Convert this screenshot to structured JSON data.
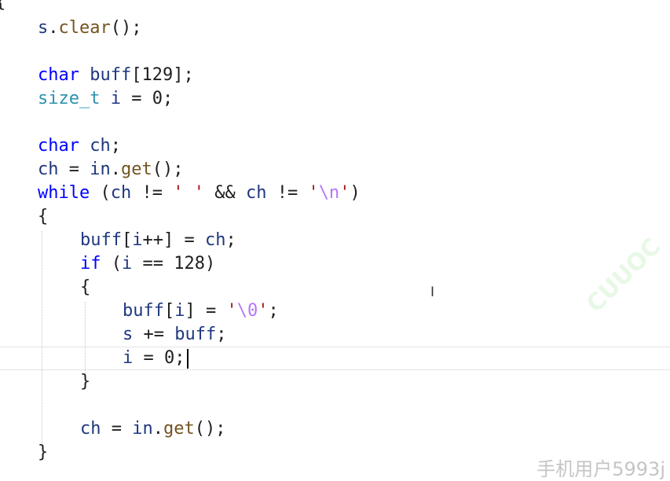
{
  "colors": {
    "keyword": "#0000ff",
    "type": "#2b91af",
    "identifier": "#1f377f",
    "function": "#74531f",
    "string": "#a31515",
    "escape": "#b776fb",
    "default": "#1e1e1e",
    "number": "#1e1e1e"
  },
  "icons": {
    "caret": "text-caret",
    "mouse": "ibeam-cursor"
  },
  "ibeam_glyph": "I",
  "top_fragment": "{",
  "watermark": "手机用户5993j",
  "ghost_watermark": "CUUOC",
  "code_lines": [
    {
      "tokens": [
        [
          "s",
          "identifier"
        ],
        [
          ".",
          "default"
        ],
        [
          "clear",
          "function"
        ],
        [
          "();",
          "default"
        ]
      ]
    },
    {
      "tokens": []
    },
    {
      "tokens": [
        [
          "char",
          "keyword"
        ],
        [
          " ",
          "default"
        ],
        [
          "buff",
          "identifier"
        ],
        [
          "[129];",
          "default"
        ]
      ]
    },
    {
      "tokens": [
        [
          "size_t",
          "type"
        ],
        [
          " ",
          "default"
        ],
        [
          "i",
          "identifier"
        ],
        [
          " = 0;",
          "default"
        ]
      ]
    },
    {
      "tokens": []
    },
    {
      "tokens": [
        [
          "char",
          "keyword"
        ],
        [
          " ",
          "default"
        ],
        [
          "ch",
          "identifier"
        ],
        [
          ";",
          "default"
        ]
      ]
    },
    {
      "tokens": [
        [
          "ch",
          "identifier"
        ],
        [
          " = ",
          "default"
        ],
        [
          "in",
          "identifier"
        ],
        [
          ".",
          "default"
        ],
        [
          "get",
          "function"
        ],
        [
          "();",
          "default"
        ]
      ]
    },
    {
      "tokens": [
        [
          "while",
          "keyword"
        ],
        [
          " (",
          "default"
        ],
        [
          "ch",
          "identifier"
        ],
        [
          " != ",
          "default"
        ],
        [
          "' '",
          "string"
        ],
        [
          " && ",
          "default"
        ],
        [
          "ch",
          "identifier"
        ],
        [
          " != ",
          "default"
        ],
        [
          "'",
          "string"
        ],
        [
          "\\n",
          "escape"
        ],
        [
          "'",
          "string"
        ],
        [
          ")",
          "default"
        ]
      ]
    },
    {
      "tokens": [
        [
          "{",
          "default"
        ]
      ]
    },
    {
      "tokens": [
        [
          "buff",
          "identifier"
        ],
        [
          "[",
          "default"
        ],
        [
          "i",
          "identifier"
        ],
        [
          "++] = ",
          "default"
        ],
        [
          "ch",
          "identifier"
        ],
        [
          ";",
          "default"
        ]
      ]
    },
    {
      "tokens": [
        [
          "if",
          "keyword"
        ],
        [
          " (",
          "default"
        ],
        [
          "i",
          "identifier"
        ],
        [
          " == 128)",
          "default"
        ]
      ]
    },
    {
      "tokens": [
        [
          "{",
          "default"
        ]
      ]
    },
    {
      "tokens": [
        [
          "buff",
          "identifier"
        ],
        [
          "[",
          "default"
        ],
        [
          "i",
          "identifier"
        ],
        [
          "] = ",
          "default"
        ],
        [
          "'",
          "string"
        ],
        [
          "\\0",
          "escape"
        ],
        [
          "'",
          "string"
        ],
        [
          ";",
          "default"
        ]
      ]
    },
    {
      "tokens": [
        [
          "s",
          "identifier"
        ],
        [
          " += ",
          "default"
        ],
        [
          "buff",
          "identifier"
        ],
        [
          ";",
          "default"
        ]
      ]
    },
    {
      "tokens": [
        [
          "i",
          "identifier"
        ],
        [
          " = 0;",
          "default"
        ]
      ]
    },
    {
      "tokens": [
        [
          "}",
          "default"
        ]
      ]
    },
    {
      "tokens": []
    },
    {
      "tokens": [
        [
          "ch",
          "identifier"
        ],
        [
          " = ",
          "default"
        ],
        [
          "in",
          "identifier"
        ],
        [
          ".",
          "default"
        ],
        [
          "get",
          "function"
        ],
        [
          "();",
          "default"
        ]
      ]
    },
    {
      "tokens": [
        [
          "}",
          "default"
        ]
      ]
    }
  ]
}
